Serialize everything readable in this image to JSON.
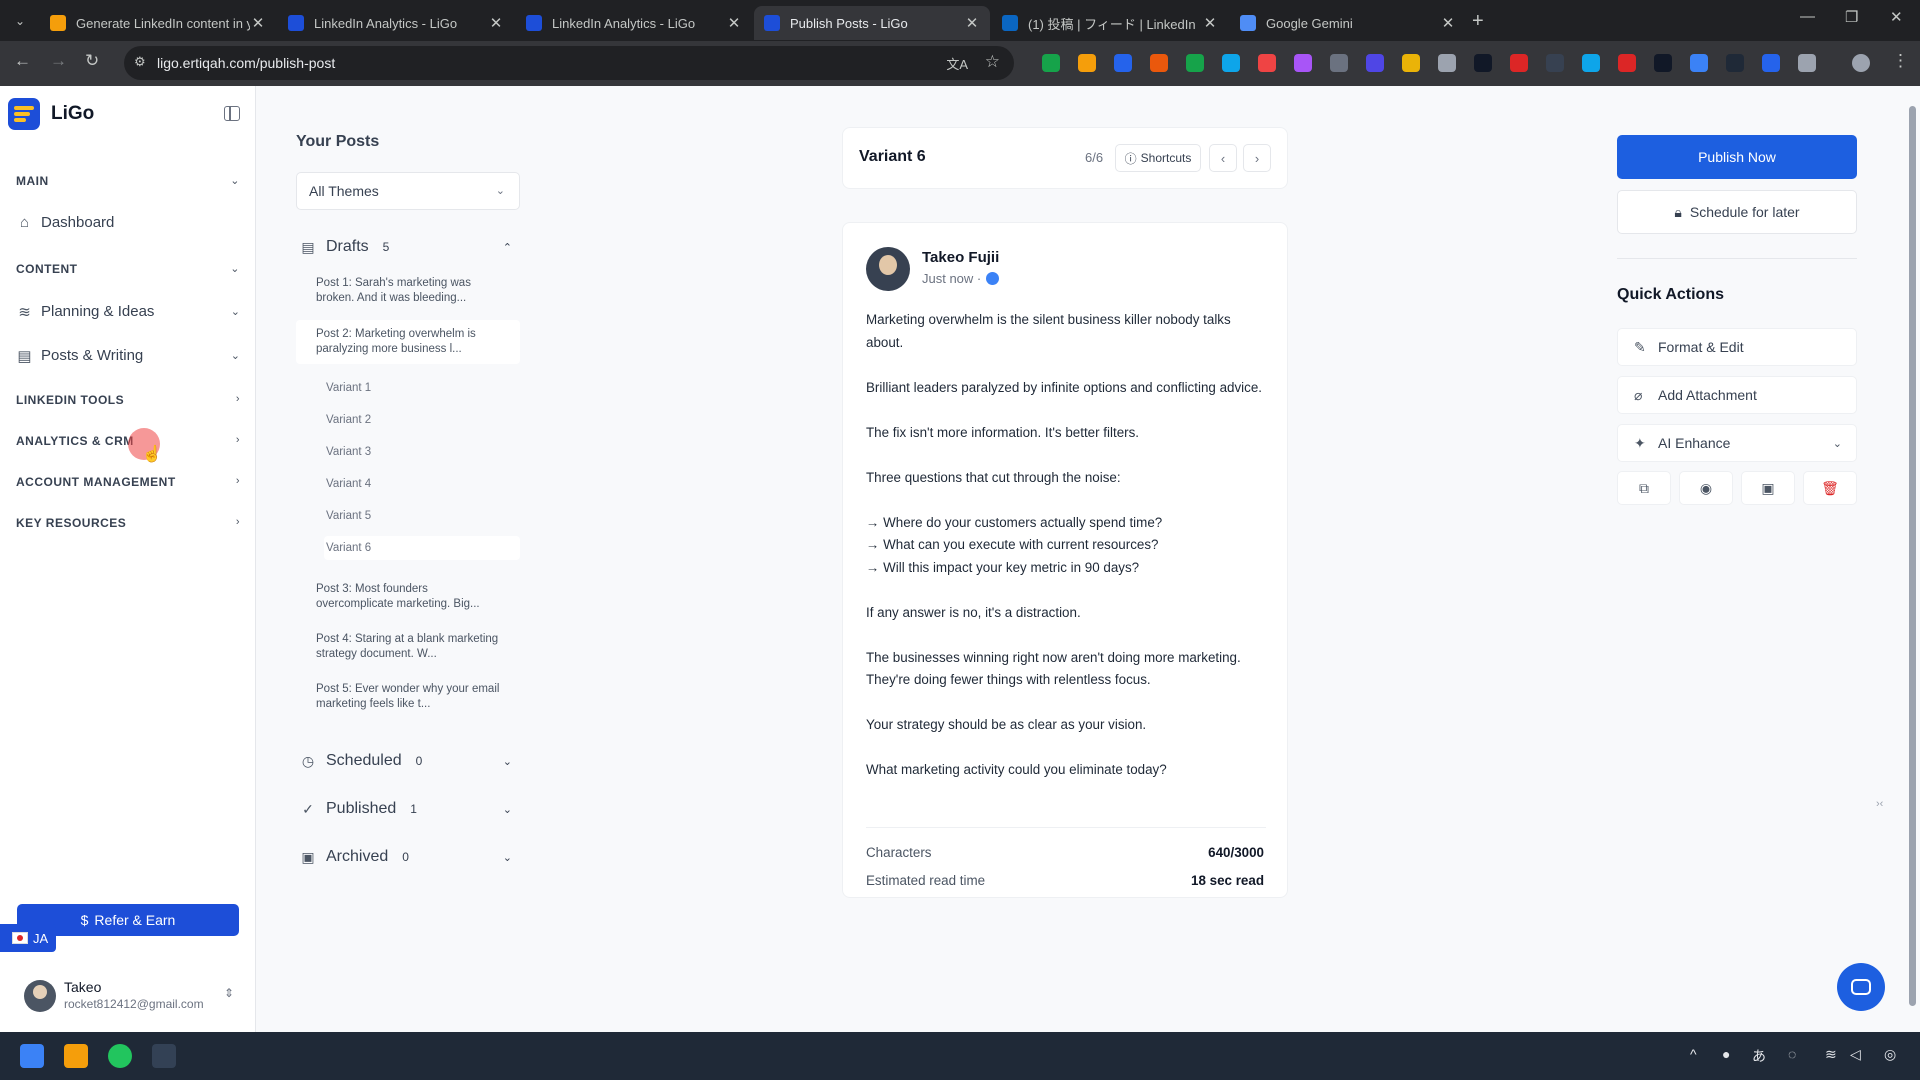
{
  "browser": {
    "tabs": [
      {
        "title": "Generate LinkedIn content in y",
        "color": "#f59e0b",
        "active": false
      },
      {
        "title": "LinkedIn Analytics - LiGo",
        "color": "#1d4ed8",
        "active": false
      },
      {
        "title": "LinkedIn Analytics - LiGo",
        "color": "#1d4ed8",
        "active": false
      },
      {
        "title": "Publish Posts - LiGo",
        "color": "#1d4ed8",
        "active": true
      },
      {
        "title": "(1) 投稿 | フィード | LinkedIn",
        "color": "#0a66c2",
        "active": false
      },
      {
        "title": "Google Gemini",
        "color": "#4f8df5",
        "active": false
      }
    ],
    "url": "ligo.ertiqah.com/publish-post"
  },
  "sidebar": {
    "brand": "LiGo",
    "sections": {
      "main": "MAIN",
      "content": "CONTENT",
      "linkedin_tools": "LINKEDIN TOOLS",
      "analytics": "ANALYTICS & CRM",
      "account": "ACCOUNT MANAGEMENT",
      "resources": "KEY RESOURCES"
    },
    "items": {
      "dashboard": "Dashboard",
      "planning": "Planning & Ideas",
      "posts": "Posts & Writing"
    },
    "refer": "Refer & Earn",
    "lang": "JA",
    "user": {
      "name": "Takeo",
      "email": "rocket812412@gmail.com"
    }
  },
  "posts": {
    "title": "Your Posts",
    "theme_filter": "All Themes",
    "drafts": {
      "label": "Drafts",
      "count": "5"
    },
    "draft_items": [
      "Post 1: Sarah's marketing was broken. And it was bleeding...",
      "Post 2: Marketing overwhelm is paralyzing more business l...",
      "Post 3: Most founders overcomplicate marketing. Big...",
      "Post 4: Staring at a blank marketing strategy document. W...",
      "Post 5: Ever wonder why your email marketing feels like t..."
    ],
    "variants": [
      "Variant 1",
      "Variant 2",
      "Variant 3",
      "Variant 4",
      "Variant 5",
      "Variant 6"
    ],
    "scheduled": {
      "label": "Scheduled",
      "count": "0"
    },
    "published": {
      "label": "Published",
      "count": "1"
    },
    "archived": {
      "label": "Archived",
      "count": "0"
    }
  },
  "preview": {
    "variant_title": "Variant 6",
    "counter": "6/6",
    "shortcuts": "Shortcuts",
    "author": "Takeo Fujii",
    "meta": "Just now ·",
    "body": [
      "Marketing overwhelm is the silent business killer nobody talks about.",
      "",
      "Brilliant leaders paralyzed by infinite options and conflicting advice.",
      "",
      "The fix isn't more information. It's better filters.",
      "",
      "Three questions that cut through the noise:",
      "",
      "→ Where do your customers actually spend time?",
      "→ What can you execute with current resources?",
      "→ Will this impact your key metric in 90 days?",
      "",
      "If any answer is no, it's a distraction.",
      "",
      "The businesses winning right now aren't doing more marketing. They're doing fewer things with relentless focus.",
      "",
      "Your strategy should be as clear as your vision.",
      "",
      "What marketing activity could you eliminate today?"
    ],
    "characters_label": "Characters",
    "characters_value": "640/3000",
    "read_label": "Estimated read time",
    "read_value": "18 sec read"
  },
  "actions": {
    "publish": "Publish Now",
    "schedule": "Schedule for later",
    "quick_title": "Quick Actions",
    "format": "Format & Edit",
    "attachment": "Add Attachment",
    "enhance": "AI Enhance"
  },
  "colors": {
    "primary": "#1d5fe0",
    "danger": "#dc2626"
  }
}
